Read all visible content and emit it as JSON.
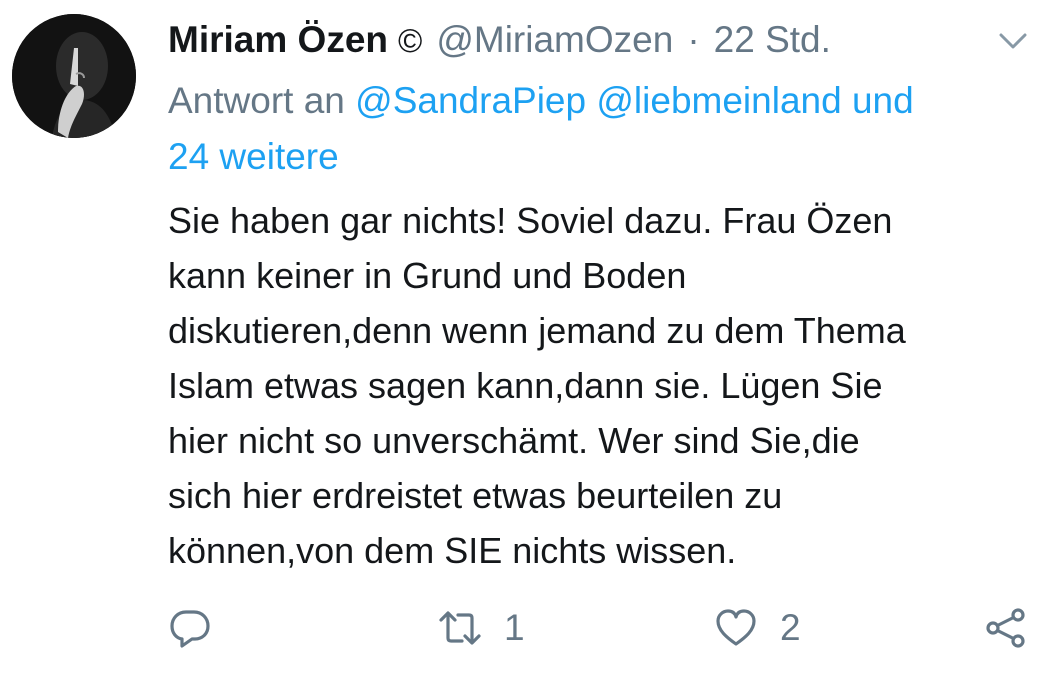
{
  "tweet": {
    "display_name": "Miriam Özen",
    "badge": "©",
    "handle": "@MiriamOzen",
    "separator": "·",
    "time": "22 Std.",
    "reply_prefix": "Antwort an",
    "mention_1": "@SandraPiep",
    "mention_2": "@liebmeinland",
    "mention_more": "und",
    "mention_more_2": "24 weitere",
    "body_lines": [
      "Sie haben gar nichts! Soviel dazu. Frau Özen",
      "kann keiner in Grund und Boden",
      "diskutieren,denn wenn jemand zu dem Thema",
      "Islam etwas sagen kann,dann sie. Lügen Sie",
      "hier nicht so unverschämt. Wer sind Sie,die",
      "sich hier erdreistet etwas beurteilen zu",
      "können,von dem SIE nichts wissen."
    ]
  },
  "actions": {
    "reply_icon": "reply-icon",
    "retweet_icon": "retweet-icon",
    "retweet_count": "1",
    "like_icon": "heart-icon",
    "like_count": "2",
    "share_icon": "share-icon"
  },
  "colors": {
    "link": "#1da1f2",
    "secondary": "#657786",
    "primary_text": "#14171a"
  }
}
